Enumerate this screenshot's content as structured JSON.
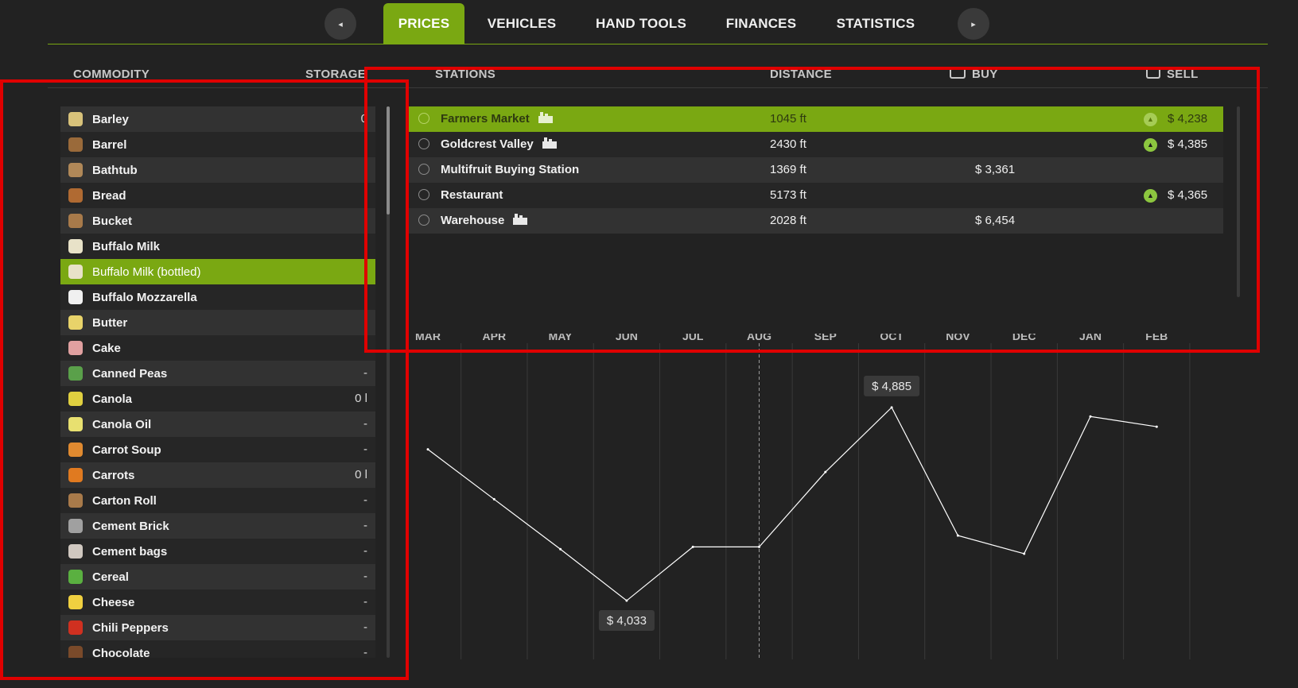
{
  "tabs": [
    {
      "label": "PRICES",
      "active": true
    },
    {
      "label": "VEHICLES",
      "active": false
    },
    {
      "label": "HAND TOOLS",
      "active": false
    },
    {
      "label": "FINANCES",
      "active": false
    },
    {
      "label": "STATISTICS",
      "active": false
    }
  ],
  "nav": {
    "prev_icon": "◂",
    "next_icon": "▸"
  },
  "headers": {
    "commodity": "COMMODITY",
    "storage": "STORAGE",
    "stations": "STATIONS",
    "distance": "DISTANCE",
    "buy": "BUY",
    "sell": "SELL"
  },
  "commodities": [
    {
      "name": "Barley",
      "storage": "0",
      "icon": "barley-icon",
      "color": "#d8c27a"
    },
    {
      "name": "Barrel",
      "storage": "",
      "icon": "barrel-icon",
      "color": "#9a6a3a"
    },
    {
      "name": "Bathtub",
      "storage": "",
      "icon": "bathtub-icon",
      "color": "#b08858"
    },
    {
      "name": "Bread",
      "storage": "",
      "icon": "bread-icon",
      "color": "#b06a32"
    },
    {
      "name": "Bucket",
      "storage": "",
      "icon": "bucket-icon",
      "color": "#a87a4a"
    },
    {
      "name": "Buffalo Milk",
      "storage": "",
      "icon": "milk-bottle-icon",
      "color": "#e8e2c8"
    },
    {
      "name": "Buffalo Milk (bottled)",
      "storage": "",
      "icon": "milk-bottle-icon",
      "color": "#e8e2c8",
      "selected": true
    },
    {
      "name": "Buffalo Mozzarella",
      "storage": "",
      "icon": "mozzarella-icon",
      "color": "#f0f0f0"
    },
    {
      "name": "Butter",
      "storage": "",
      "icon": "butter-icon",
      "color": "#e8d36a"
    },
    {
      "name": "Cake",
      "storage": "",
      "icon": "cake-icon",
      "color": "#e0a0a0"
    },
    {
      "name": "Canned Peas",
      "storage": "-",
      "icon": "can-icon",
      "color": "#5aa04a"
    },
    {
      "name": "Canola",
      "storage": "0 l",
      "icon": "canola-icon",
      "color": "#e0d040"
    },
    {
      "name": "Canola Oil",
      "storage": "-",
      "icon": "oil-icon",
      "color": "#e8e070"
    },
    {
      "name": "Carrot Soup",
      "storage": "-",
      "icon": "soup-icon",
      "color": "#e08a30"
    },
    {
      "name": "Carrots",
      "storage": "0 l",
      "icon": "carrot-icon",
      "color": "#e07a20"
    },
    {
      "name": "Carton Roll",
      "storage": "-",
      "icon": "carton-roll-icon",
      "color": "#a87a4a"
    },
    {
      "name": "Cement Brick",
      "storage": "-",
      "icon": "brick-icon",
      "color": "#a0a0a0"
    },
    {
      "name": "Cement bags",
      "storage": "-",
      "icon": "bag-icon",
      "color": "#d0c8c0"
    },
    {
      "name": "Cereal",
      "storage": "-",
      "icon": "cereal-icon",
      "color": "#5ab040"
    },
    {
      "name": "Cheese",
      "storage": "-",
      "icon": "cheese-icon",
      "color": "#f0d040"
    },
    {
      "name": "Chili Peppers",
      "storage": "-",
      "icon": "chili-icon",
      "color": "#d03020"
    },
    {
      "name": "Chocolate",
      "storage": "-",
      "icon": "chocolate-icon",
      "color": "#7a4a2a"
    }
  ],
  "stations": [
    {
      "name": "Farmers Market",
      "distance": "1045 ft",
      "buy": "",
      "sell": "$ 4,238",
      "trend": "up",
      "badge": "factory-icon",
      "selected": true
    },
    {
      "name": "Goldcrest Valley",
      "distance": "2430 ft",
      "buy": "",
      "sell": "$ 4,385",
      "trend": "up",
      "badge": "train-icon"
    },
    {
      "name": "Multifruit Buying Station",
      "distance": "1369 ft",
      "buy": "$ 3,361",
      "sell": "",
      "trend": "",
      "badge": ""
    },
    {
      "name": "Restaurant",
      "distance": "5173 ft",
      "buy": "",
      "sell": "$ 4,365",
      "trend": "up",
      "badge": ""
    },
    {
      "name": "Warehouse",
      "distance": "2028 ft",
      "buy": "$ 6,454",
      "sell": "",
      "trend": "",
      "badge": "factory-icon"
    }
  ],
  "chart_data": {
    "type": "line",
    "categories": [
      "MAR",
      "APR",
      "MAY",
      "JUN",
      "JUL",
      "AUG",
      "SEP",
      "OCT",
      "NOV",
      "DEC",
      "JAN",
      "FEB"
    ],
    "values": [
      4700,
      4480,
      4260,
      4033,
      4270,
      4270,
      4600,
      4885,
      4320,
      4240,
      4845,
      4800
    ],
    "ylim": [
      3900,
      5000
    ],
    "grid": true,
    "current_marker": "AUG",
    "annotations": [
      {
        "category": "OCT",
        "label": "$ 4,885"
      },
      {
        "category": "JUN",
        "label": "$ 4,033"
      }
    ],
    "colors": {
      "line": "#ffffff",
      "grid": "#3a3a3a"
    }
  }
}
